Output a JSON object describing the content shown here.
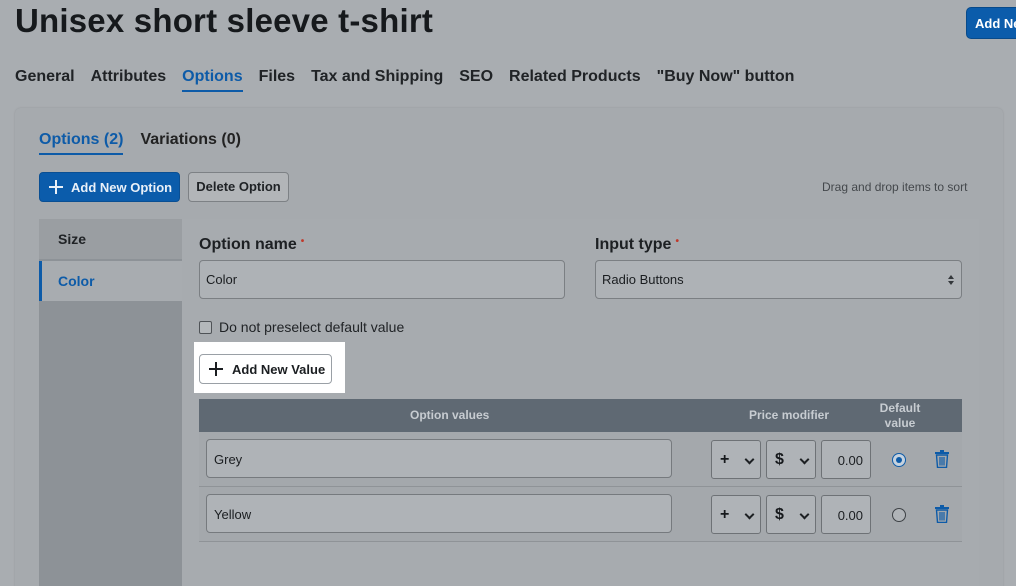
{
  "header": {
    "title": "Unisex short sleeve t-shirt",
    "add_button_label": "Add New"
  },
  "main_tabs": [
    {
      "label": "General",
      "active": false
    },
    {
      "label": "Attributes",
      "active": false
    },
    {
      "label": "Options",
      "active": true
    },
    {
      "label": "Files",
      "active": false
    },
    {
      "label": "Tax and Shipping",
      "active": false
    },
    {
      "label": "SEO",
      "active": false
    },
    {
      "label": "Related Products",
      "active": false
    },
    {
      "label": "\"Buy Now\" button",
      "active": false
    }
  ],
  "sub_tabs": [
    {
      "label": "Options (2)",
      "active": true
    },
    {
      "label": "Variations (0)",
      "active": false
    }
  ],
  "toolbar": {
    "add_option_label": "Add New Option",
    "delete_option_label": "Delete Option",
    "drag_hint": "Drag and drop items to sort"
  },
  "options_list": [
    {
      "label": "Size",
      "active": false
    },
    {
      "label": "Color",
      "active": true
    }
  ],
  "form": {
    "option_name_label": "Option name",
    "option_name_value": "Color",
    "input_type_label": "Input type",
    "input_type_value": "Radio Buttons",
    "required_marker": "•",
    "no_preselect_label": "Do not preselect default value",
    "no_preselect_checked": false,
    "add_value_label": "Add New Value"
  },
  "values_table": {
    "headers": {
      "option_values": "Option values",
      "price_modifier": "Price modifier",
      "default_value": "Default value"
    },
    "rows": [
      {
        "value": "Grey",
        "sign": "+",
        "currency": "$",
        "price": "0.00",
        "default": true
      },
      {
        "value": "Yellow",
        "sign": "+",
        "currency": "$",
        "price": "0.00",
        "default": false
      }
    ]
  },
  "colors": {
    "accent": "#0d5ba8",
    "header_bg": "#5f6973"
  },
  "icons": {
    "add": "plus-icon",
    "delete_row": "trash-icon",
    "select_arrow": "chevron-down-icon",
    "select_updown": "sort-arrows-icon"
  }
}
